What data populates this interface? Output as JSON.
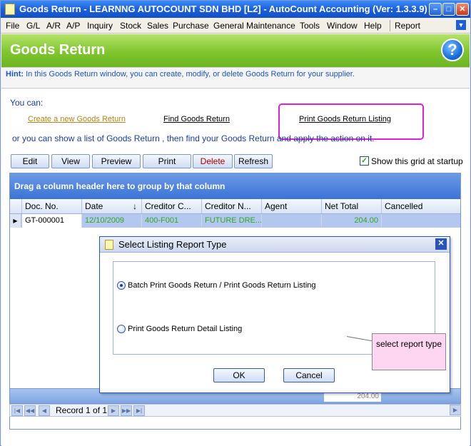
{
  "window": {
    "title": "Goods Return - LEARNNG AUTOCOUNT SDN BHD [L2] - AutoCount Accounting (Ver: 1.3.3.9)"
  },
  "menu": [
    "File",
    "G/L",
    "A/R",
    "A/P",
    "Inquiry",
    "Stock",
    "Sales",
    "Purchase",
    "General Maintenance",
    "Tools",
    "Window",
    "Help",
    "Report"
  ],
  "header": {
    "title": "Goods Return"
  },
  "hint": {
    "label": "Hint:",
    "text": " In this Goods Return window, you can create, modify, or delete Goods Return for your supplier."
  },
  "actions": {
    "you_can": "You can:",
    "create_link": "Create a new Goods Return",
    "find_link": "Find Goods Return",
    "print_link": "Print Goods Return Listing",
    "or_line": "or you can show a  list of Goods Return , then find your Goods Return and apply the action on it."
  },
  "toolbar": {
    "edit": "Edit",
    "view": "View",
    "preview": "Preview",
    "print": "Print",
    "delete": "Delete",
    "refresh": "Refresh",
    "show_grid_label": "Show this grid at startup"
  },
  "grid": {
    "group_panel": "Drag a column header here to group by that column",
    "columns": [
      "Doc. No.",
      "Date",
      "Creditor C...",
      "Creditor N...",
      "Agent",
      "Net Total",
      "Cancelled"
    ],
    "rows": [
      {
        "doc_no": "GT-000001",
        "date": "12/10/2009",
        "creditor_code": "400-F001",
        "creditor_name": "FUTURE DRE...",
        "agent": "",
        "net_total": "204.00",
        "cancelled": ""
      }
    ],
    "footer_total": "204.00",
    "record_text": "Record 1 of 1"
  },
  "dialog": {
    "title": "Select Listing Report Type",
    "option1": "Batch Print Goods Return / Print Goods Return Listing",
    "option2": "Print Goods Return Detail Listing",
    "ok": "OK",
    "cancel": "Cancel"
  },
  "callout": {
    "text": "select report type"
  }
}
